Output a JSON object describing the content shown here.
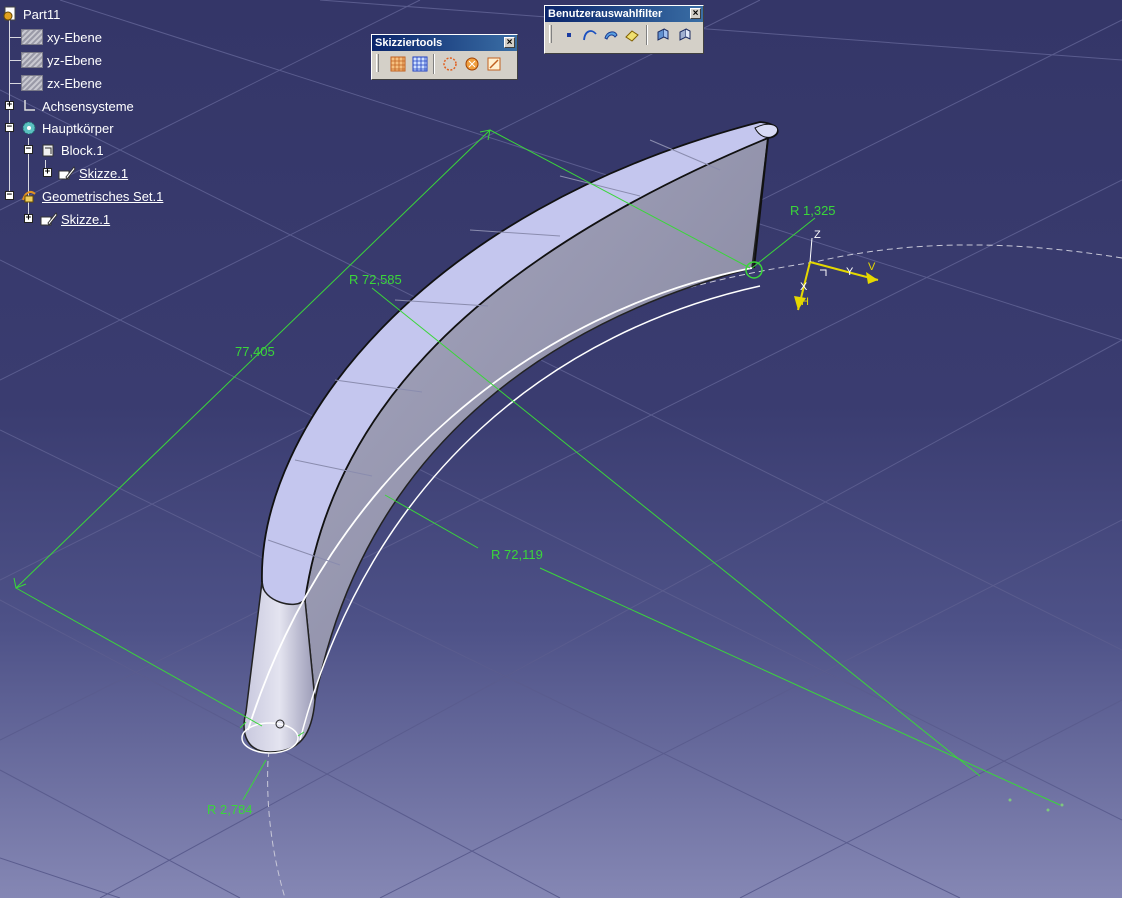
{
  "tree": {
    "root": "Part11",
    "planes": [
      "xy-Ebene",
      "yz-Ebene",
      "zx-Ebene"
    ],
    "axis_systems": "Achsensysteme",
    "main_body": "Hauptkörper",
    "pad": "Block.1",
    "pad_sketch": "Skizze.1",
    "geo_set": "Geometrisches Set.1",
    "geo_sketch": "Skizze.1"
  },
  "toolbars": {
    "sketch_tools": {
      "title": "Skizziertools",
      "close": "×"
    },
    "user_selection_filter": {
      "title": "Benutzerauswahlfilter",
      "close": "×"
    }
  },
  "dimensions": {
    "r_small_top": "R 1,325",
    "r_outer": "R 72,585",
    "length": "77,405",
    "r_inner": "R 72,119",
    "r_small_bottom": "R 2,784"
  },
  "axes": {
    "x": "X",
    "y": "Y",
    "z": "Z",
    "h": "H",
    "v": "V"
  },
  "colors": {
    "background_top": "#343668",
    "background_bottom": "#8587b4",
    "dimension_green": "#3ad63a",
    "axis_yellow": "#e5d800",
    "part_face": "#c2c4ec",
    "part_side": "#9c9cb8"
  }
}
